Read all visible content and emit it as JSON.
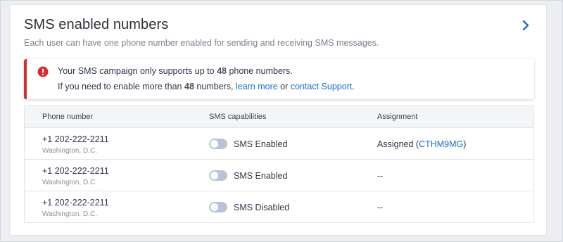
{
  "header": {
    "title": "SMS enabled numbers",
    "subtitle": "Each user can have one phone number enabled for sending and receiving SMS messages."
  },
  "alert": {
    "line1_pre": "Your SMS campaign only supports up to ",
    "line1_num": "48",
    "line1_post": " phone numbers.",
    "line2_pre": "If you need to enable more than ",
    "line2_num": "48",
    "line2_mid": " numbers, ",
    "learn_more": "learn more",
    "line2_or": " or ",
    "contact_support": "contact Support",
    "line2_end": ".",
    "icon": "error-icon",
    "accent": "#d92d2d"
  },
  "table": {
    "headers": [
      "Phone number",
      "SMS capabilities",
      "Assignment"
    ],
    "rows": [
      {
        "phone": "+1 202-222-2211",
        "city": "Washington, D.C.",
        "sms": "SMS Enabled",
        "assign_pre": "Assigned (",
        "assign_link": "CTHM9MG",
        "assign_post": ")"
      },
      {
        "phone": "+1 202-222-2211",
        "city": "Washington, D.C.",
        "sms": "SMS Enabled",
        "assign_pre": "--",
        "assign_link": "",
        "assign_post": ""
      },
      {
        "phone": "+1 202-222-2211",
        "city": "Washington, D.C.",
        "sms": "SMS Disabled",
        "assign_pre": "--",
        "assign_link": "",
        "assign_post": ""
      }
    ]
  },
  "colors": {
    "link": "#1a6dc9",
    "toggle_off": "#b7c3d6"
  }
}
